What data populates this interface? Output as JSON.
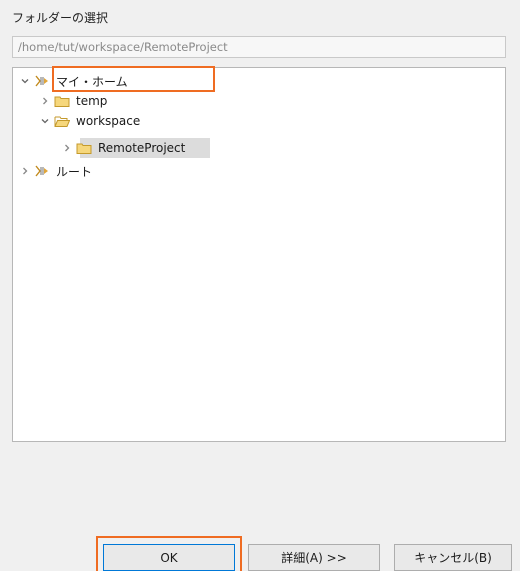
{
  "dialog": {
    "title": "フォルダーの選択",
    "path_value": "/home/tut/workspace/RemoteProject"
  },
  "tree": {
    "items": [
      {
        "label": "マイ・ホーム",
        "expanded": true,
        "icon": "home-link-icon"
      },
      {
        "label": "temp",
        "expanded": false,
        "icon": "folder-icon"
      },
      {
        "label": "workspace",
        "expanded": true,
        "icon": "folder-open-icon"
      },
      {
        "label": "RemoteProject",
        "expanded": false,
        "icon": "folder-icon",
        "selected": true
      },
      {
        "label": "ルート",
        "expanded": false,
        "icon": "home-link-icon"
      }
    ]
  },
  "buttons": {
    "ok": "OK",
    "detail": "詳細(A) >>",
    "cancel": "キャンセル(B)"
  },
  "colors": {
    "highlight": "#ef6c22",
    "focus": "#0078d7",
    "folder": "#e8b84a"
  }
}
